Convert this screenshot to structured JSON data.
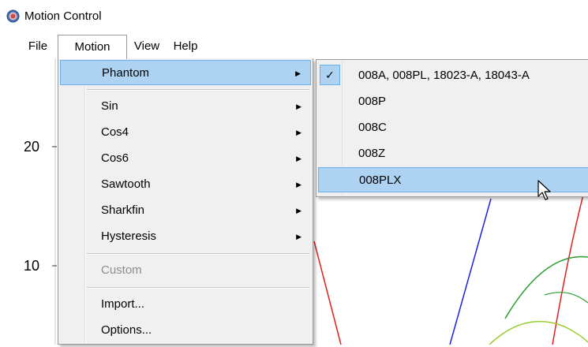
{
  "window": {
    "title": "Motion Control"
  },
  "menubar": {
    "items": [
      "File",
      "Motion",
      "View",
      "Help"
    ]
  },
  "plot": {
    "y_ticks": [
      "20",
      "10"
    ]
  },
  "motion_menu": {
    "items": [
      {
        "label": "Phantom",
        "arrow": "▶"
      },
      {
        "label": "Sin",
        "arrow": "▶"
      },
      {
        "label": "Cos4",
        "arrow": "▶"
      },
      {
        "label": "Cos6",
        "arrow": "▶"
      },
      {
        "label": "Sawtooth",
        "arrow": "▶"
      },
      {
        "label": "Sharkfin",
        "arrow": "▶"
      },
      {
        "label": "Hysteresis",
        "arrow": "▶"
      },
      {
        "label": "Custom"
      },
      {
        "label": "Import..."
      },
      {
        "label": "Options..."
      }
    ]
  },
  "phantom_submenu": {
    "items": [
      {
        "label": "008A, 008PL, 18023-A, 18043-A",
        "checked": true
      },
      {
        "label": "008P"
      },
      {
        "label": "008C"
      },
      {
        "label": "008Z"
      },
      {
        "label": "008PLX"
      }
    ],
    "check_glyph": "✓"
  },
  "colors": {
    "highlight": "#aed3f2",
    "highlight_border": "#6bb0e6",
    "menu_bg": "#f0f0f0"
  }
}
